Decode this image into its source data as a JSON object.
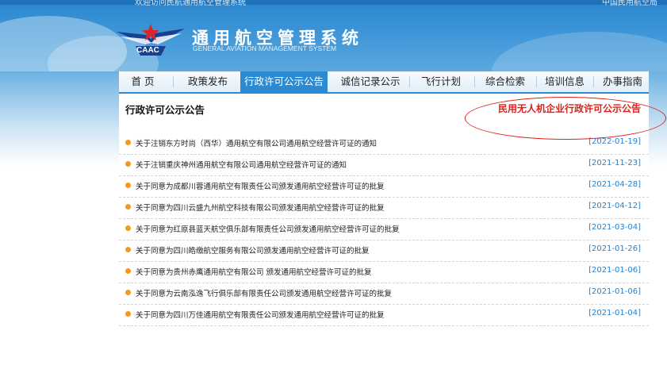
{
  "header": {
    "top_left_text": "欢迎访问民航通用航空管理系统",
    "top_right_text": "中国民用航空局",
    "logo_text": "CAAC",
    "system_title": "通用航空管理系统",
    "system_subtitle": "GENERAL AVIATION MANAGEMENT SYSTEM"
  },
  "nav": {
    "items": [
      {
        "label": "首 页"
      },
      {
        "label": "政策发布"
      },
      {
        "label": "行政许可公示公告",
        "active": true
      },
      {
        "label": "诚信记录公示"
      },
      {
        "label": "飞行计划"
      },
      {
        "label": "综合检索"
      },
      {
        "label": "培训信息"
      },
      {
        "label": "办事指南"
      }
    ]
  },
  "main": {
    "section_title": "行政许可公示公告",
    "uav_link": "民用无人机企业行政许可公示公告",
    "notices": [
      {
        "title": "关于注销东方时尚（西华）通用航空有限公司通用航空经营许可证的通知",
        "date": "2022-01-19"
      },
      {
        "title": "关于注销重庆神州通用航空有限公司通用航空经营许可证的通知",
        "date": "2021-11-23"
      },
      {
        "title": "关于同意为成都川蓉通用航空有限责任公司颁发通用航空经营许可证的批复",
        "date": "2021-04-28"
      },
      {
        "title": "关于同意为四川云盛九州航空科技有限公司颁发通用航空经营许可证的批复",
        "date": "2021-04-12"
      },
      {
        "title": "关于同意为红原县蓝天航空俱乐部有限责任公司颁发通用航空经营许可证的批复",
        "date": "2021-03-04"
      },
      {
        "title": "关于同意为四川皓缴航空服务有限公司颁发通用航空经营许可证的批复",
        "date": "2021-01-26"
      },
      {
        "title": "关于同意为贵州赤鹰通用航空有限公司 颁发通用航空经营许可证的批复",
        "date": "2021-01-06"
      },
      {
        "title": "关于同意为云南泓逸飞行俱乐部有限责任公司颁发通用航空经营许可证的批复",
        "date": "2021-01-06"
      },
      {
        "title": "关于同意为四川万佳通用航空有限责任公司颁发通用航空经营许可证的批复",
        "date": "2021-01-04"
      }
    ]
  },
  "colors": {
    "nav_active": "#2b8ad2",
    "header_blue": "#3d95d7",
    "link_red": "#e0201a",
    "bullet_orange": "#f29a1e",
    "date_blue": "#2b7fc8"
  }
}
